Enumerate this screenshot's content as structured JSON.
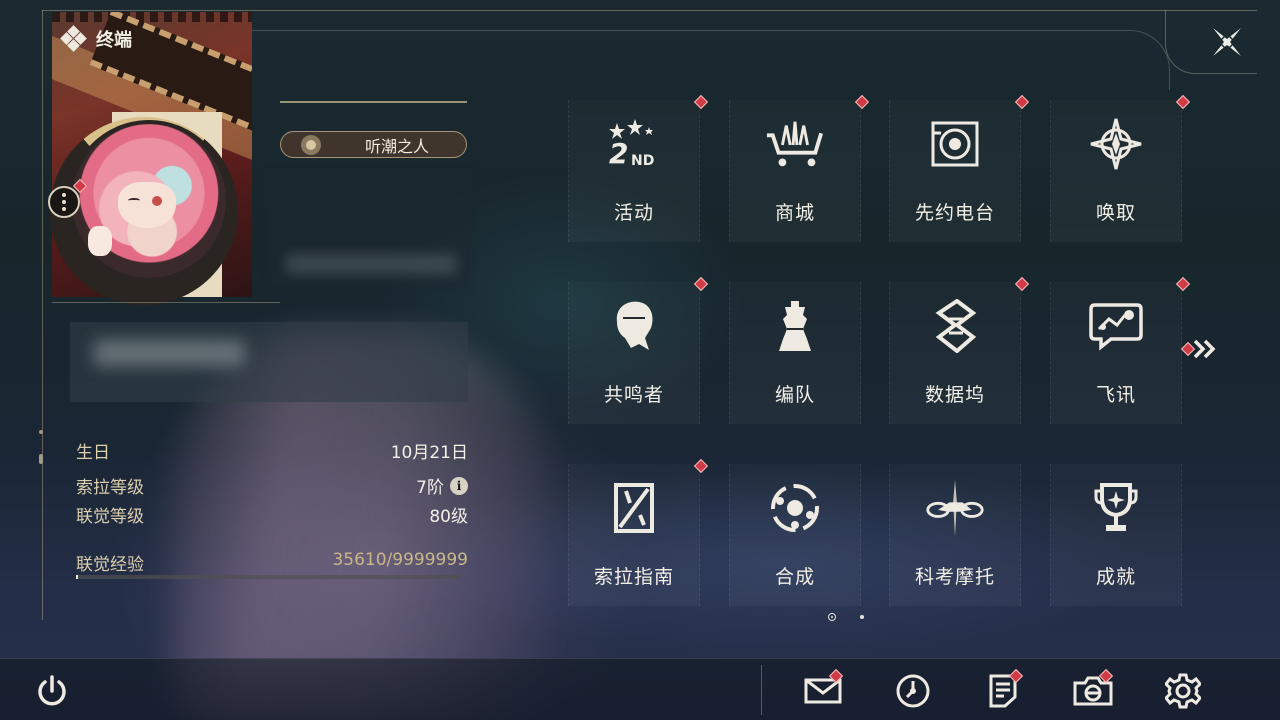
{
  "header": {
    "title": "终端"
  },
  "profile": {
    "nickname": "听潮之人",
    "stats": [
      {
        "label": "生日",
        "value": "10月21日"
      },
      {
        "label": "索拉等级",
        "value": "7阶"
      },
      {
        "label": "联觉等级",
        "value": "80级"
      }
    ],
    "info_icon": "i",
    "exp": {
      "label": "联觉经验",
      "value": "35610/9999999",
      "progress": 0.0036
    }
  },
  "grid": {
    "items": [
      {
        "label": "活动",
        "icon": "event-2nd-anniversary-icon",
        "badge": true
      },
      {
        "label": "商城",
        "icon": "shop-cart-icon",
        "badge": true
      },
      {
        "label": "先约电台",
        "icon": "pioneer-radio-icon",
        "badge": true
      },
      {
        "label": "唤取",
        "icon": "convene-star-icon",
        "badge": true
      },
      {
        "label": "共鸣者",
        "icon": "resonator-portrait-icon",
        "badge": true
      },
      {
        "label": "编队",
        "icon": "team-chess-icon",
        "badge": false
      },
      {
        "label": "数据坞",
        "icon": "data-bank-icon",
        "badge": true
      },
      {
        "label": "飞讯",
        "icon": "message-chat-icon",
        "badge": true
      },
      {
        "label": "索拉指南",
        "icon": "solaris-guide-icon",
        "badge": true
      },
      {
        "label": "合成",
        "icon": "synthesis-orbit-icon",
        "badge": false
      },
      {
        "label": "科考摩托",
        "icon": "motorcycle-icon",
        "badge": false
      },
      {
        "label": "成就",
        "icon": "trophy-icon",
        "badge": false
      }
    ],
    "pages": 2,
    "current_page": 1
  },
  "bottom_bar": {
    "items": [
      {
        "name": "mail",
        "icon": "mail-icon",
        "badge": true
      },
      {
        "name": "history",
        "icon": "clock-icon",
        "badge": false
      },
      {
        "name": "notice",
        "icon": "notice-icon",
        "badge": true
      },
      {
        "name": "camera",
        "icon": "camera-icon",
        "badge": true
      },
      {
        "name": "settings",
        "icon": "gear-icon",
        "badge": false
      }
    ]
  },
  "colors": {
    "accent_gold": "#d9c08a",
    "badge_red": "#d13b45",
    "text": "#f2efe6"
  }
}
